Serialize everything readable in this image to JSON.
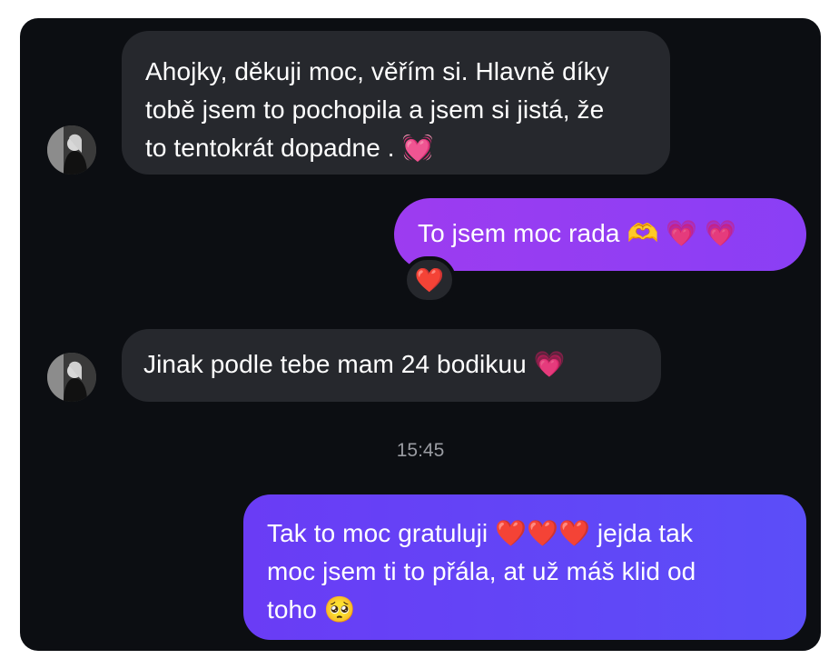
{
  "chat": {
    "messages": [
      {
        "direction": "incoming",
        "lines": [
          "Ahojky, děkuji moc, věřím si. Hlavně díky",
          "tobě jsem to pochopila a jsem si jistá, že",
          "to tentokrát dopadne . 💓"
        ]
      },
      {
        "direction": "outgoing",
        "text": "To jsem moc rada 🫶 💗 💗",
        "reaction": "❤️"
      },
      {
        "direction": "incoming",
        "text": "Jinak podle tebe mam 24 bodikuu 💗"
      },
      {
        "direction": "outgoing",
        "lines": [
          "Tak to moc gratuluji ❤️❤️❤️ jejda tak",
          "moc jsem ti to přála, at už máš klid od",
          "toho 🥺"
        ]
      }
    ],
    "timestamp": "15:45"
  },
  "colors": {
    "background": "#0c0e12",
    "incoming_bubble": "#26282d",
    "outgoing_bubble_1": "#9d3cf0",
    "outgoing_bubble_2": "#5b4ef8",
    "timestamp_text": "#9a9ca2"
  },
  "icons": {
    "avatar": "contact-avatar-photo"
  }
}
